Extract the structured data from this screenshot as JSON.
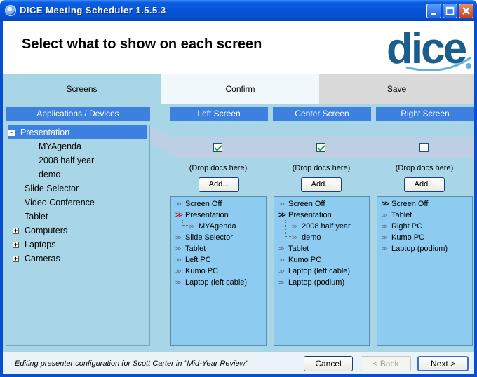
{
  "window": {
    "title": "DICE Meeting Scheduler 1.5.5.3"
  },
  "header": {
    "title": "Select what to show on each screen",
    "logo_text": "dice"
  },
  "tabs": [
    {
      "label": "Screens"
    },
    {
      "label": "Confirm"
    },
    {
      "label": "Save"
    }
  ],
  "left_panel": {
    "title": "Applications / Devices",
    "items": [
      {
        "label": "Presentation",
        "expander": "−"
      },
      {
        "label": "MYAgenda"
      },
      {
        "label": "2008 half year"
      },
      {
        "label": "demo"
      },
      {
        "label": "Slide Selector"
      },
      {
        "label": "Video Conference"
      },
      {
        "label": "Tablet"
      },
      {
        "label": "Computers",
        "expander": "+"
      },
      {
        "label": "Laptops",
        "expander": "+"
      },
      {
        "label": "Cameras",
        "expander": "+"
      }
    ]
  },
  "screens": [
    {
      "title": "Left Screen",
      "checked": true,
      "drop_text": "(Drop docs here)",
      "add_label": "Add...",
      "items": [
        {
          "label": "Screen Off",
          "marker": ">>"
        },
        {
          "label": "Presentation",
          "marker": ">>",
          "active": true
        },
        {
          "label": "MYAgenda",
          "marker": ">>",
          "child": true
        },
        {
          "label": "Slide Selector",
          "marker": ">>"
        },
        {
          "label": "Tablet",
          "marker": ">>"
        },
        {
          "label": "Left PC",
          "marker": ">>"
        },
        {
          "label": "Kumo PC",
          "marker": ">>"
        },
        {
          "label": "Laptop (left cable)",
          "marker": ">>"
        }
      ]
    },
    {
      "title": "Center Screen",
      "checked": true,
      "drop_text": "(Drop docs here)",
      "add_label": "Add...",
      "items": [
        {
          "label": "Screen Off",
          "marker": ">>"
        },
        {
          "label": "Presentation",
          "marker": ">>",
          "active": true
        },
        {
          "label": "2008 half year",
          "marker": ">>",
          "child": true
        },
        {
          "label": "demo",
          "marker": ">>",
          "child": true
        },
        {
          "label": "Tablet",
          "marker": ">>"
        },
        {
          "label": "Kumo PC",
          "marker": ">>"
        },
        {
          "label": "Laptop (left cable)",
          "marker": ">>"
        },
        {
          "label": "Laptop (podium)",
          "marker": ">>"
        }
      ]
    },
    {
      "title": "Right Screen",
      "checked": false,
      "drop_text": "(Drop docs here)",
      "add_label": "Add...",
      "items": [
        {
          "label": "Screen Off",
          "marker": ">>",
          "active": true
        },
        {
          "label": "Tablet",
          "marker": ">>"
        },
        {
          "label": "Right PC",
          "marker": ">>"
        },
        {
          "label": "Kumo PC",
          "marker": ">>"
        },
        {
          "label": "Laptop (podium)",
          "marker": ">>"
        }
      ]
    }
  ],
  "footer": {
    "status": "Editing presenter configuration for Scott Carter in \"Mid-Year Review\"",
    "cancel_label": "Cancel",
    "back_label": "< Back",
    "next_label": "Next >"
  },
  "colors": {
    "accent": "#3d80e0",
    "content_bg": "#a9d6e6",
    "list_bg": "#8ecbf0",
    "active_marker": "#c81a1a",
    "logo": "#1a5e8c"
  }
}
